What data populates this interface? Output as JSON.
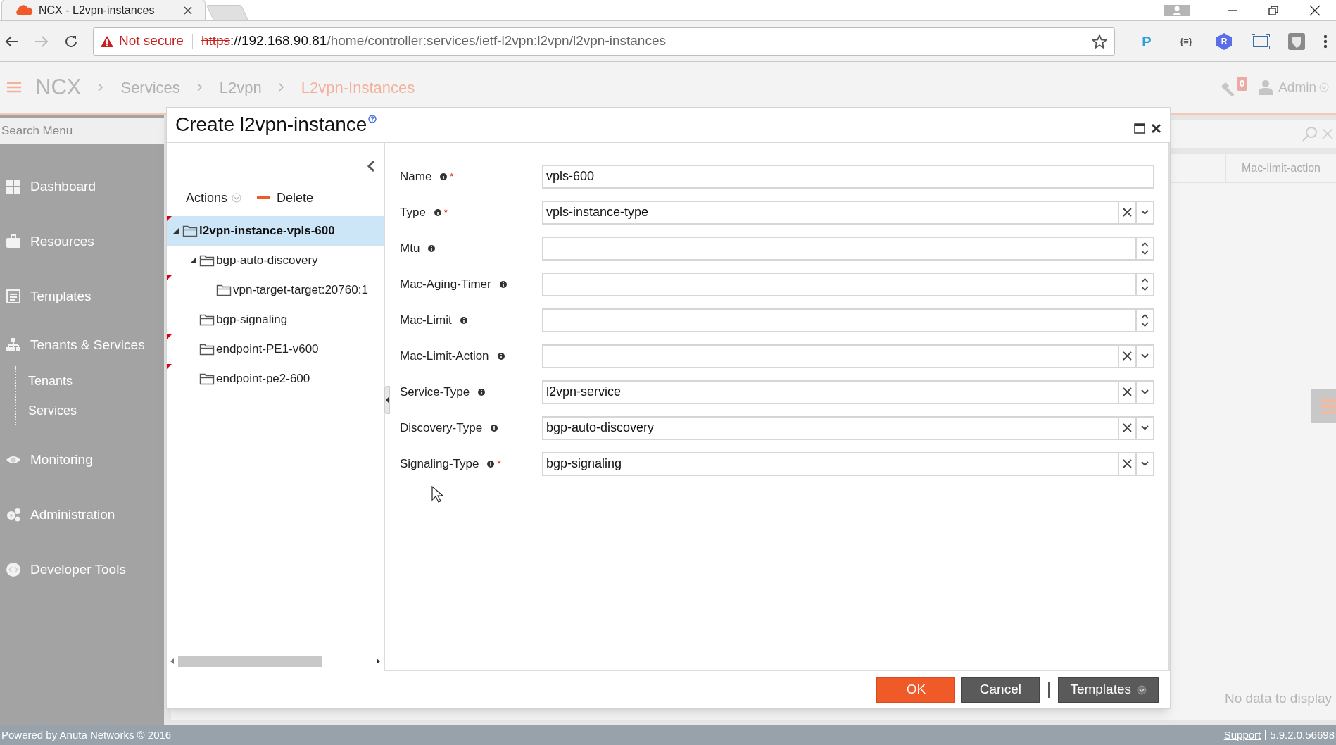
{
  "browser": {
    "tab_title": "NCX - L2vpn-instances",
    "security": "Not secure",
    "url_scheme": "https",
    "url_host": "://192.168.90.81",
    "url_path": "/home/controller:services/ietf-l2vpn:l2vpn/l2vpn-instances"
  },
  "extensions": [
    {
      "kind": "letter",
      "label": "P",
      "color": "#2a9fd8"
    },
    {
      "kind": "letter",
      "label": "{≡}",
      "color": "#555555"
    },
    {
      "kind": "hex",
      "label": "R",
      "color": "#5b6ee8"
    },
    {
      "kind": "screen"
    },
    {
      "kind": "shield"
    }
  ],
  "header": {
    "app": "NCX",
    "breadcrumbs": [
      {
        "label": "Services",
        "current": false
      },
      {
        "label": "L2vpn",
        "current": false
      },
      {
        "label": "L2vpn-Instances",
        "current": true
      }
    ],
    "notifications": "0",
    "user": "Admin"
  },
  "sidebar": {
    "search_placeholder": "Search Menu",
    "items": [
      {
        "label": "Dashboard",
        "kind": "dashboard"
      },
      {
        "label": "Resources",
        "kind": "briefcase"
      },
      {
        "label": "Templates",
        "kind": "form"
      },
      {
        "label": "Tenants & Services",
        "kind": "hierarchy",
        "children": [
          {
            "label": "Tenants"
          },
          {
            "label": "Services"
          }
        ]
      },
      {
        "label": "Monitoring",
        "kind": "eye"
      },
      {
        "label": "Administration",
        "kind": "gears"
      },
      {
        "label": "Developer Tools",
        "kind": "code"
      }
    ]
  },
  "background_table": {
    "columns": [
      "Mac-limit-action"
    ],
    "empty_text": "No data to display"
  },
  "dialog": {
    "title": "Create l2vpn-instance",
    "actions_label": "Actions",
    "delete_label": "Delete",
    "required_mark": "*",
    "tree": [
      {
        "label": "l2vpn-instance-vpls-600",
        "selected": true,
        "expanded": true,
        "error": true,
        "children": [
          {
            "label": "bgp-auto-discovery",
            "selected": false,
            "expanded": true,
            "error": false,
            "children": [
              {
                "label": "vpn-target-target:20760:1",
                "selected": false,
                "error": true
              }
            ]
          },
          {
            "label": "bgp-signaling",
            "selected": false,
            "error": false
          },
          {
            "label": "endpoint-PE1-v600",
            "selected": false,
            "error": true
          },
          {
            "label": "endpoint-pe2-600",
            "selected": false,
            "error": true
          }
        ]
      }
    ],
    "fields": [
      {
        "label": "Name",
        "kind": "text",
        "required": true,
        "value": "vpls-600"
      },
      {
        "label": "Type",
        "kind": "select",
        "required": true,
        "value": "vpls-instance-type"
      },
      {
        "label": "Mtu",
        "kind": "number",
        "required": false
      },
      {
        "label": "Mac-Aging-Timer",
        "kind": "number",
        "required": false
      },
      {
        "label": "Mac-Limit",
        "kind": "number",
        "required": false
      },
      {
        "label": "Mac-Limit-Action",
        "kind": "select",
        "required": false
      },
      {
        "label": "Service-Type",
        "kind": "select",
        "required": false,
        "value": "l2vpn-service"
      },
      {
        "label": "Discovery-Type",
        "kind": "select",
        "required": false,
        "value": "bgp-auto-discovery"
      },
      {
        "label": "Signaling-Type",
        "kind": "select",
        "required": true,
        "value": "bgp-signaling"
      }
    ],
    "buttons": [
      {
        "label": "OK",
        "kind": "primary"
      },
      {
        "label": "Cancel",
        "kind": "secondary"
      },
      {
        "label": "Templates",
        "kind": "menu"
      }
    ]
  },
  "footer": {
    "powered_by": "Powered by Anuta Networks © 2016",
    "support": "Support",
    "version": "5.9.2.0.56698"
  }
}
